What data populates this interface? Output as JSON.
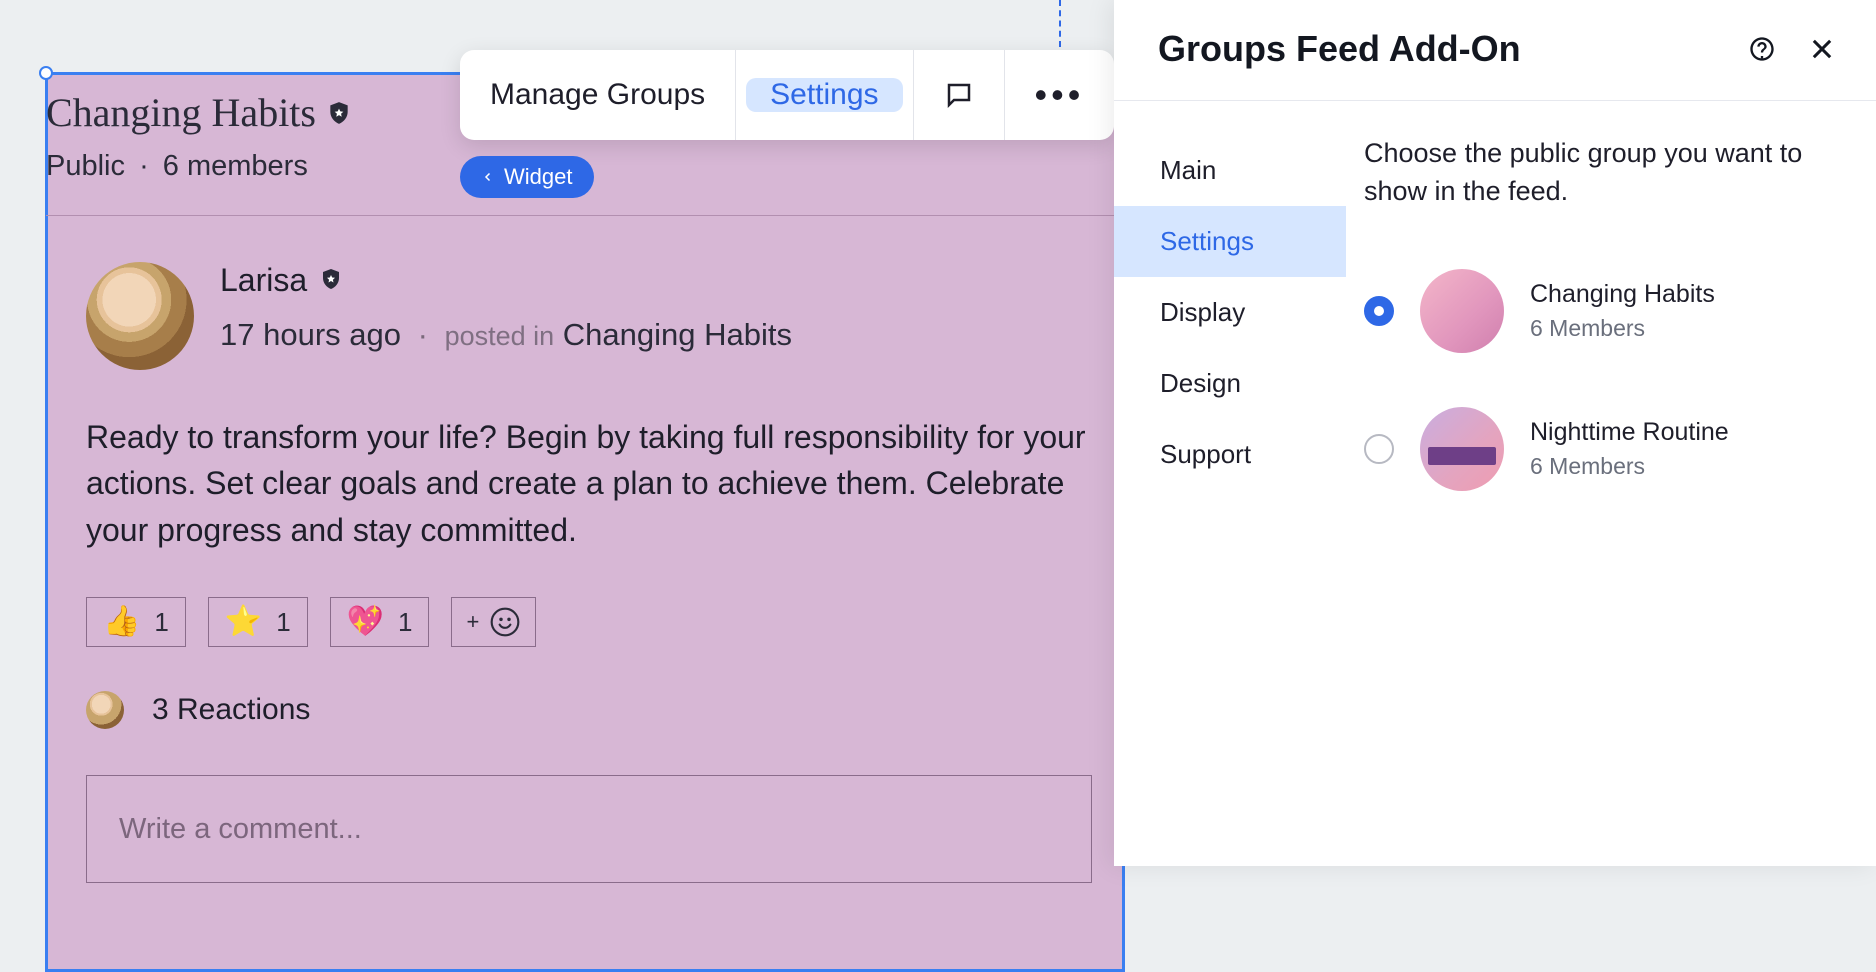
{
  "group": {
    "title": "Changing Habits",
    "visibility": "Public",
    "member_count_text": "6 members"
  },
  "toolbar": {
    "manage_label": "Manage Groups",
    "settings_label": "Settings",
    "widget_label": "Widget"
  },
  "post": {
    "author": "Larisa",
    "time_ago": "17 hours ago",
    "posted_in_label": "posted in",
    "posted_in_group": "Changing Habits",
    "body": "Ready to transform your life? Begin by taking full responsibility for your actions. Set clear goals and create a plan to achieve them. Celebrate your progress and stay committed.",
    "reactions": [
      {
        "emoji": "👍",
        "count": 1
      },
      {
        "emoji": "⭐",
        "count": 1
      },
      {
        "emoji": "💖",
        "count": 1
      }
    ],
    "reactions_summary": "3 Reactions",
    "comment_placeholder": "Write a comment..."
  },
  "panel": {
    "title": "Groups Feed Add-On",
    "nav": {
      "main": "Main",
      "settings": "Settings",
      "display": "Display",
      "design": "Design",
      "support": "Support"
    },
    "description": "Choose the public group you want to show in the feed.",
    "groups": [
      {
        "name": "Changing Habits",
        "members": "6 Members",
        "selected": true
      },
      {
        "name": "Nighttime Routine",
        "members": "6 Members",
        "selected": false
      }
    ]
  }
}
